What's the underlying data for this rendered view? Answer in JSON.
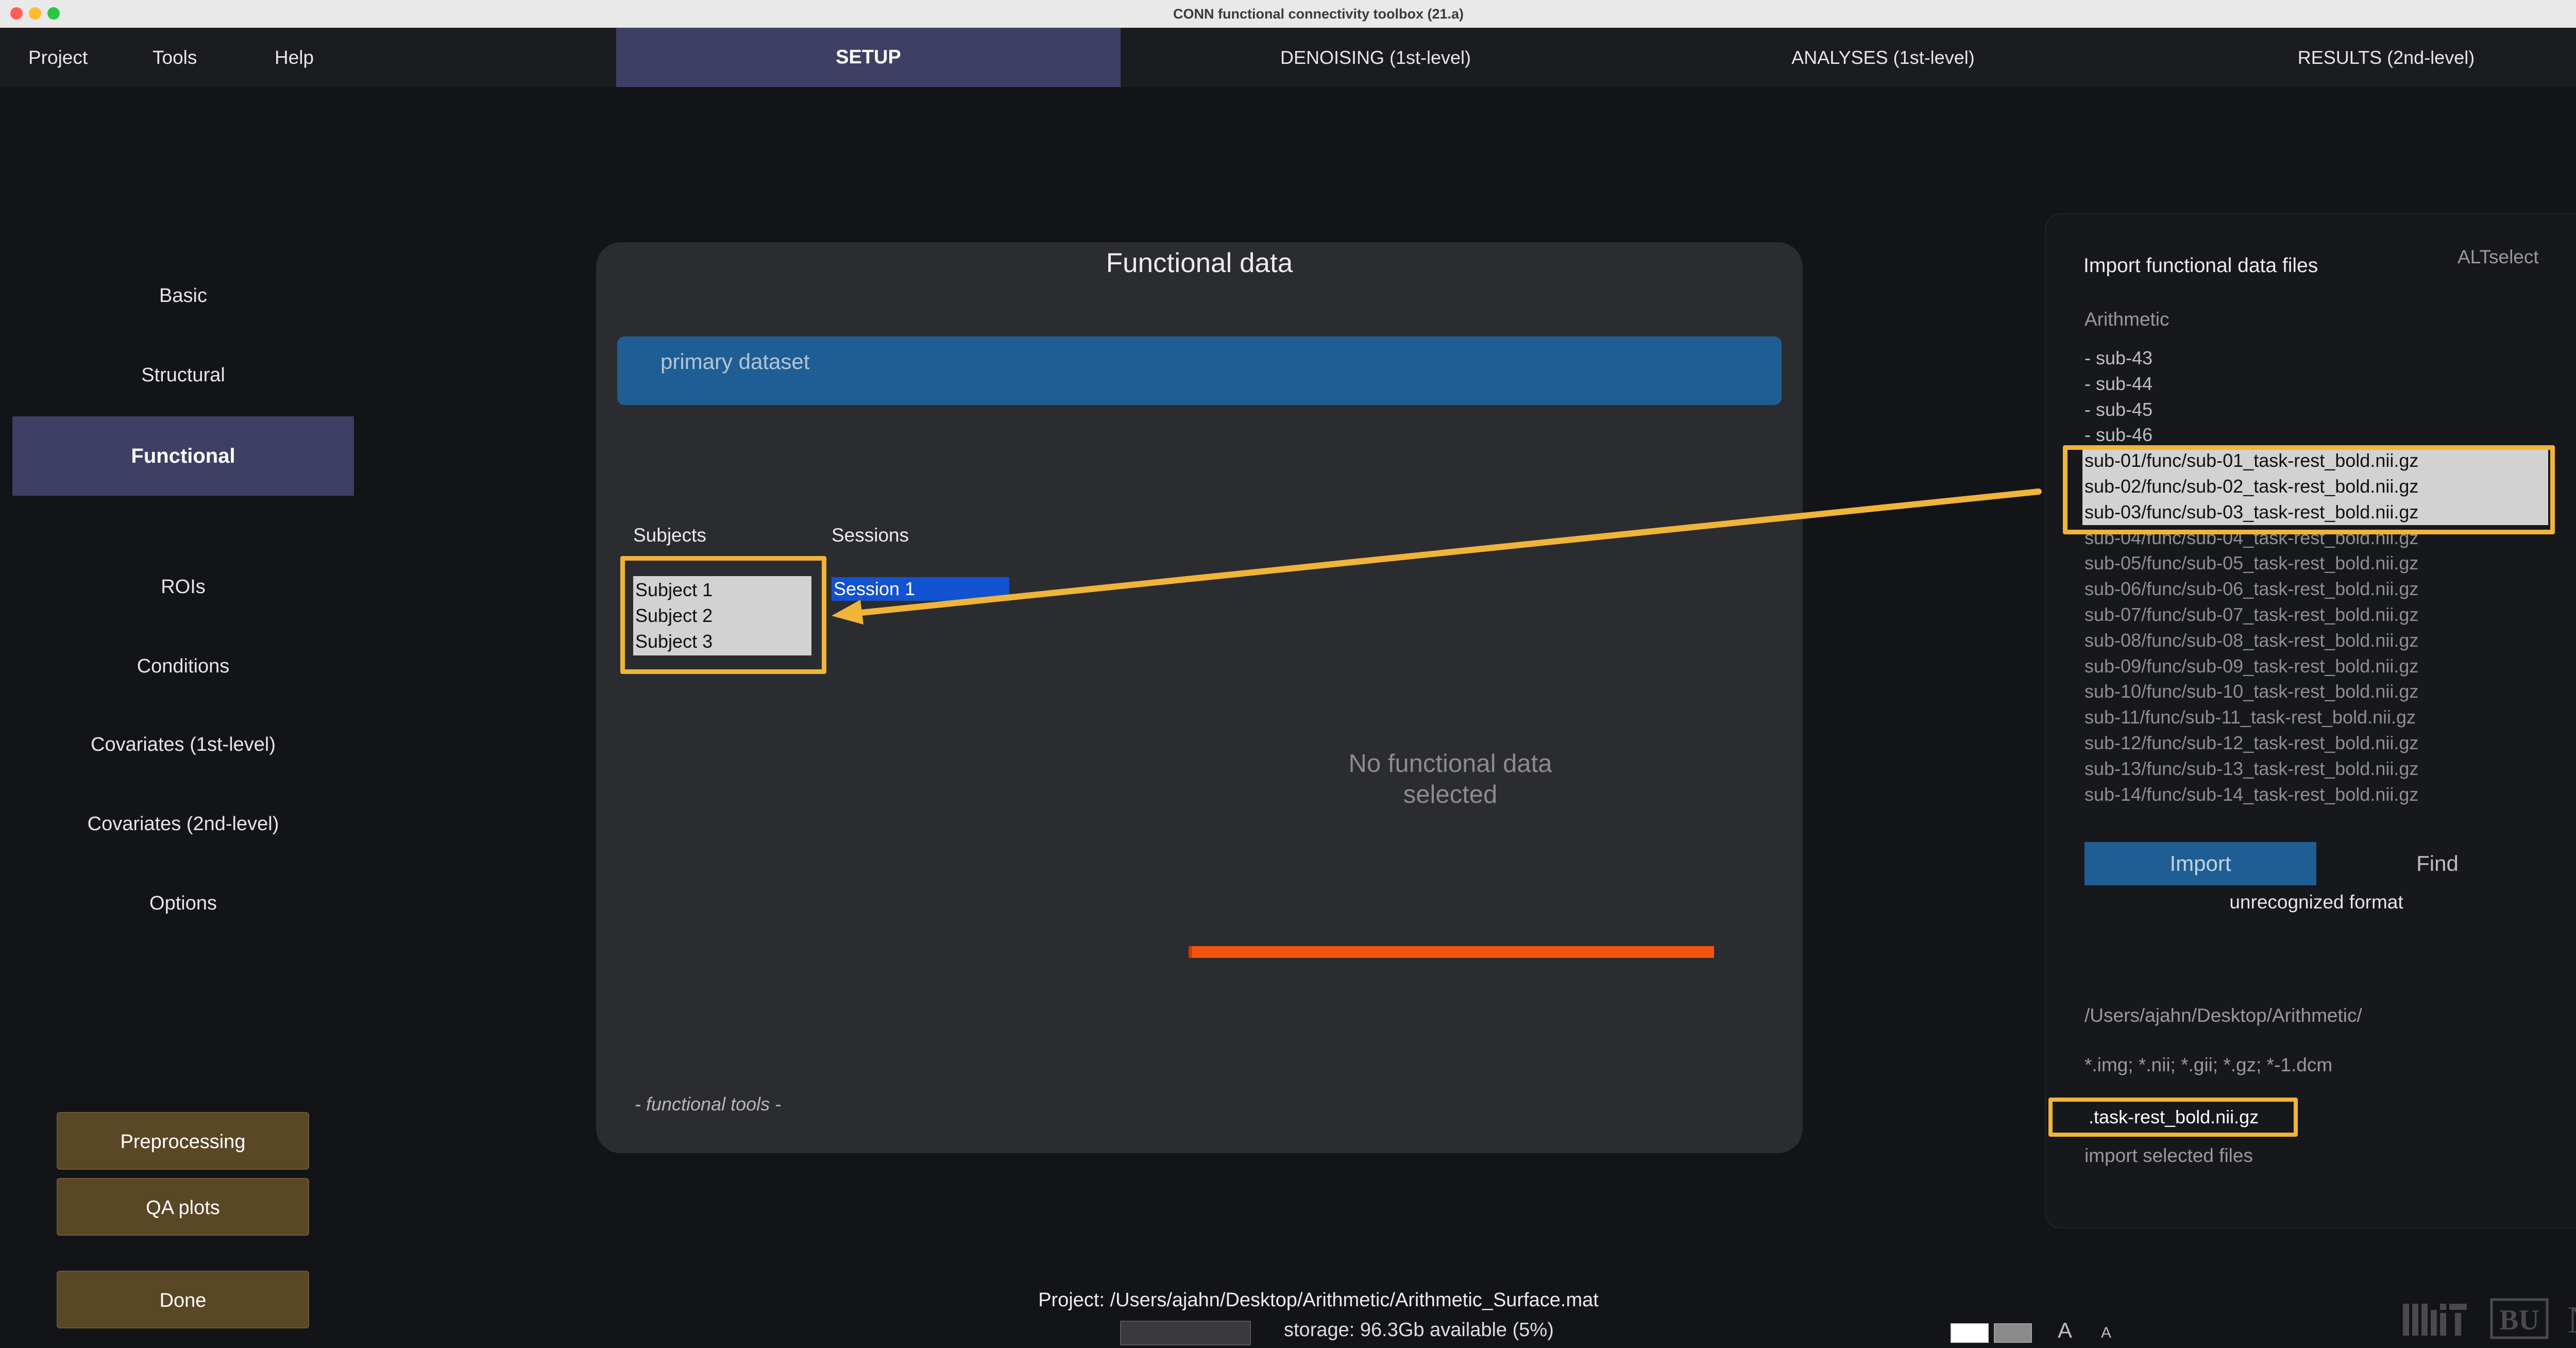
{
  "window": {
    "title": "CONN functional connectivity toolbox (21.a)"
  },
  "menu": {
    "project": "Project",
    "tools": "Tools",
    "help": "Help"
  },
  "tabs": {
    "setup": "SETUP",
    "denoising": "DENOISING (1st-level)",
    "analyses": "ANALYSES (1st-level)",
    "results": "RESULTS (2nd-level)"
  },
  "sidebar": {
    "items": [
      {
        "label": "Basic"
      },
      {
        "label": "Structural"
      },
      {
        "label": "Functional",
        "active": true
      },
      {
        "label": "ROIs"
      },
      {
        "label": "Conditions"
      },
      {
        "label": "Covariates (1st-level)"
      },
      {
        "label": "Covariates (2nd-level)"
      },
      {
        "label": "Options"
      }
    ],
    "buttons": {
      "preprocessing": "Preprocessing",
      "qa_plots": "QA plots",
      "done": "Done"
    }
  },
  "panel": {
    "title": "Functional data",
    "dataset": "primary dataset",
    "subjects_header": "Subjects",
    "sessions_header": "Sessions",
    "subjects": [
      "Subject 1",
      "Subject 2",
      "Subject 3"
    ],
    "sessions": [
      "Session 1"
    ],
    "empty_message": "No functional data selected",
    "tools_label": "- functional tools -"
  },
  "import_panel": {
    "title": "Import functional data files",
    "altselect": "ALTselect",
    "folder": "Arithmetic",
    "files": [
      {
        "name": "- sub-43",
        "type": "folder"
      },
      {
        "name": "- sub-44",
        "type": "folder"
      },
      {
        "name": "- sub-45",
        "type": "folder"
      },
      {
        "name": "- sub-46",
        "type": "folder"
      },
      {
        "name": "sub-01/func/sub-01_task-rest_bold.nii.gz",
        "selected": true
      },
      {
        "name": "sub-02/func/sub-02_task-rest_bold.nii.gz",
        "selected": true
      },
      {
        "name": "sub-03/func/sub-03_task-rest_bold.nii.gz",
        "selected": true
      },
      {
        "name": "sub-04/func/sub-04_task-rest_bold.nii.gz"
      },
      {
        "name": "sub-05/func/sub-05_task-rest_bold.nii.gz"
      },
      {
        "name": "sub-06/func/sub-06_task-rest_bold.nii.gz"
      },
      {
        "name": "sub-07/func/sub-07_task-rest_bold.nii.gz"
      },
      {
        "name": "sub-08/func/sub-08_task-rest_bold.nii.gz"
      },
      {
        "name": "sub-09/func/sub-09_task-rest_bold.nii.gz"
      },
      {
        "name": "sub-10/func/sub-10_task-rest_bold.nii.gz"
      },
      {
        "name": "sub-11/func/sub-11_task-rest_bold.nii.gz"
      },
      {
        "name": "sub-12/func/sub-12_task-rest_bold.nii.gz"
      },
      {
        "name": "sub-13/func/sub-13_task-rest_bold.nii.gz"
      },
      {
        "name": "sub-14/func/sub-14_task-rest_bold.nii.gz"
      }
    ],
    "import_button": "Import",
    "find_button": "Find",
    "format_status": "unrecognized format",
    "path": "/Users/ajahn/Desktop/Arithmetic/",
    "filter": "*.img; *.nii; *.gii; *.gz; *-1.dcm",
    "filter_value": ".task-rest_bold.nii.gz",
    "import_selected": "import selected files"
  },
  "footer": {
    "project_path": "Project: /Users/ajahn/Desktop/Arithmetic/Arithmetic_Surface.mat",
    "storage": "storage: 96.3Gb available (5%)",
    "font_large": "A",
    "font_small": "A",
    "logos": [
      "MIT",
      "BU",
      "N"
    ]
  },
  "colors": {
    "accent_tab": "#3d3f64",
    "dataset_bar": "#1e5e94",
    "highlight_frame": "#f1b43a",
    "session_selected": "#1352d0",
    "progress": "#f2530f",
    "tool_button": "#5a4726"
  }
}
